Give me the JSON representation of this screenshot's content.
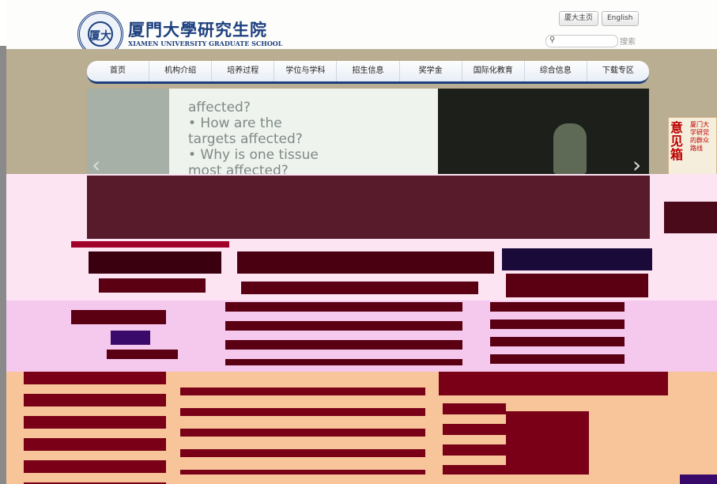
{
  "header": {
    "title_cn": "厦門大學研究生院",
    "title_en": "XIAMEN UNIVERSITY GRADUATE SCHOOL",
    "logo_glyph": "厦大",
    "links": [
      {
        "label": "厦大主页"
      },
      {
        "label": "English"
      }
    ],
    "search": {
      "placeholder": "",
      "button_label": "搜索",
      "icon": "search-icon"
    }
  },
  "nav": {
    "items": [
      {
        "label": "首页"
      },
      {
        "label": "机构介绍"
      },
      {
        "label": "培养过程"
      },
      {
        "label": "学位与学科"
      },
      {
        "label": "招生信息"
      },
      {
        "label": "奖学金"
      },
      {
        "label": "国际化教育"
      },
      {
        "label": "综合信息"
      },
      {
        "label": "下载专区"
      }
    ]
  },
  "banner": {
    "slide_lines": [
      "affected?",
      "• How are the",
      "targets affected?",
      "• Why is one tissue",
      "most affected?"
    ],
    "prev_icon": "chevron-left-icon",
    "next_icon": "chevron-right-icon"
  },
  "feedback": {
    "main_label": "意见箱",
    "side_label": "厦门大学研党的群众路线"
  },
  "colors": {
    "brand": "#1d3f7f",
    "khaki": "#b9ad92",
    "corrupt_pink": "#fce4f2",
    "corrupt_magenta": "#f5c8ee",
    "corrupt_orange": "#f8c59a",
    "corrupt_maroon": "#5a0012"
  }
}
